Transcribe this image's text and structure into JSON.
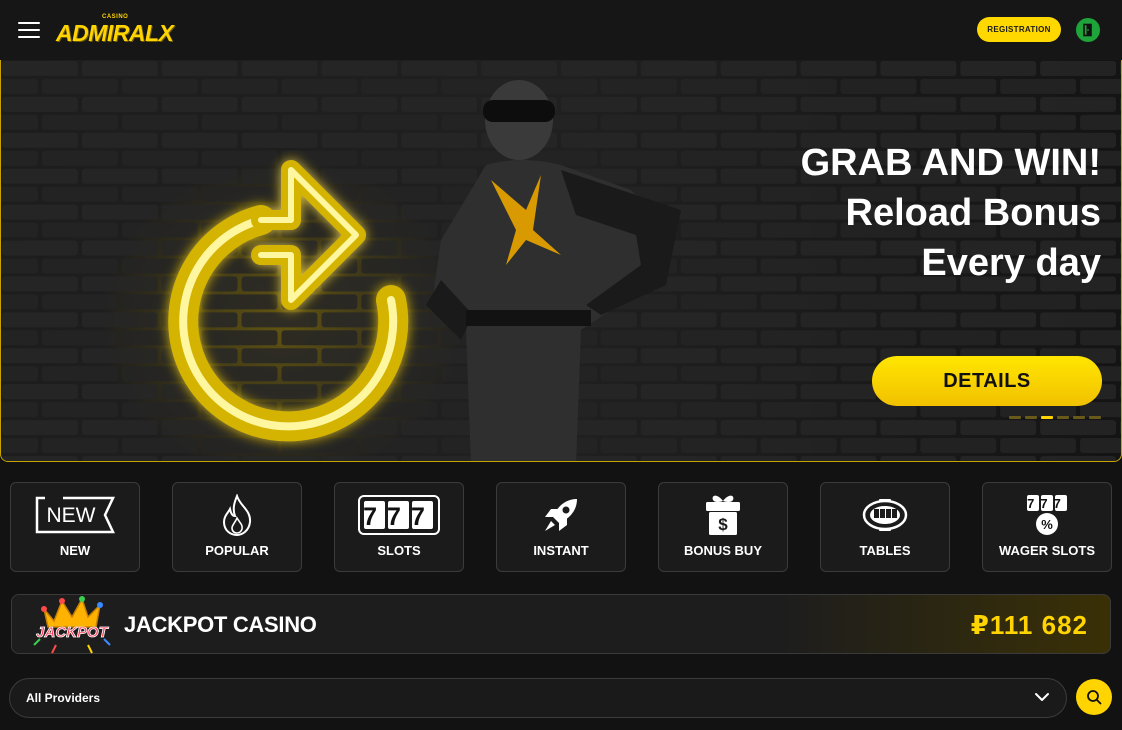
{
  "header": {
    "logo_small": "CASINO",
    "logo_main": "ADMIRAL",
    "logo_x": "X",
    "register_label": "REGISTRATION",
    "menu_icon": "menu-icon",
    "login_icon": "login-door-icon"
  },
  "banner": {
    "line1": "GRAB AND WIN!",
    "line2": "Reload Bonus",
    "line3": "Every day",
    "details_label": "DETAILS",
    "slides_total": 6,
    "active_slide": 3
  },
  "categories": [
    {
      "label": "NEW",
      "icon": "new-tag-icon",
      "icon_text": "NEW"
    },
    {
      "label": "POPULAR",
      "icon": "flame-icon"
    },
    {
      "label": "SLOTS",
      "icon": "slots-777-icon",
      "icon_text": "777"
    },
    {
      "label": "INSTANT",
      "icon": "rocket-icon"
    },
    {
      "label": "BONUS BUY",
      "icon": "gift-dollar-icon",
      "icon_text": "$"
    },
    {
      "label": "TABLES",
      "icon": "cards-table-icon"
    },
    {
      "label": "WAGER SLOTS",
      "icon": "wager-777-icon",
      "icon_text": "777",
      "icon_sub": "%"
    }
  ],
  "jackpot": {
    "logo_text": "JACKPOT",
    "title": "JACKPOT CASINO",
    "amount": "₽111 682"
  },
  "providers": {
    "selected": "All Providers",
    "search_icon": "search-icon"
  },
  "colors": {
    "accent": "#ffd400",
    "login": "#1fa43a",
    "background": "#121212"
  }
}
